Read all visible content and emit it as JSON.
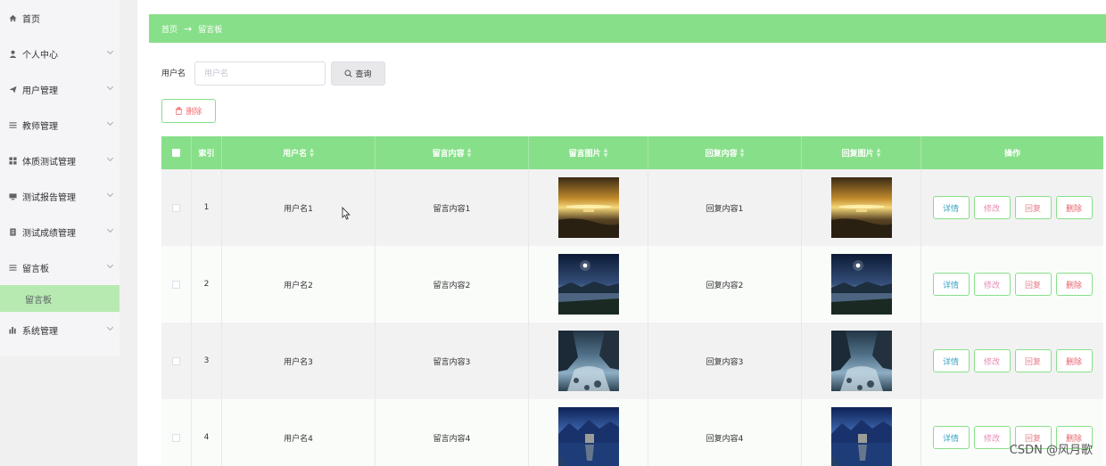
{
  "sidebar": {
    "items": [
      {
        "label": "首页",
        "icon": "home-icon",
        "chevron": false
      },
      {
        "label": "个人中心",
        "icon": "user-icon",
        "chevron": true
      },
      {
        "label": "用户管理",
        "icon": "send-icon",
        "chevron": true
      },
      {
        "label": "教师管理",
        "icon": "menu-lines-icon",
        "chevron": true
      },
      {
        "label": "体质测试管理",
        "icon": "grid-icon",
        "chevron": true
      },
      {
        "label": "测试报告管理",
        "icon": "monitor-icon",
        "chevron": true
      },
      {
        "label": "测试成绩管理",
        "icon": "document-icon",
        "chevron": true
      },
      {
        "label": "留言板",
        "icon": "menu-lines-icon",
        "chevron": true
      }
    ],
    "sub_item": "留言板",
    "last_item": {
      "label": "系统管理",
      "icon": "bar-chart-icon"
    }
  },
  "breadcrumb": {
    "home": "首页",
    "arrow": "→",
    "current": "留言板"
  },
  "search": {
    "label": "用户名",
    "placeholder": "用户名",
    "value": "",
    "button": "查询"
  },
  "toolbar": {
    "delete_label": "删除"
  },
  "table": {
    "headers": [
      "索引",
      "用户名",
      "留言内容",
      "留言图片",
      "回复内容",
      "回复图片",
      "操作"
    ],
    "rows": [
      {
        "index": "1",
        "user": "用户名1",
        "content": "留言内容1",
        "reply": "回复内容1",
        "scene": "sunset"
      },
      {
        "index": "2",
        "user": "用户名2",
        "content": "留言内容2",
        "reply": "回复内容2",
        "scene": "night-lake"
      },
      {
        "index": "3",
        "user": "用户名3",
        "content": "留言内容3",
        "reply": "回复内容3",
        "scene": "river"
      },
      {
        "index": "4",
        "user": "用户名4",
        "content": "留言内容4",
        "reply": "回复内容4",
        "scene": "blue-lake"
      }
    ],
    "actions": [
      "详情",
      "修改",
      "回复",
      "删除"
    ]
  },
  "colors": {
    "accent": "#88df8a",
    "sidebar_active": "#b6eab1",
    "danger": "#f56c6c"
  },
  "watermark": "CSDN @风月歌"
}
